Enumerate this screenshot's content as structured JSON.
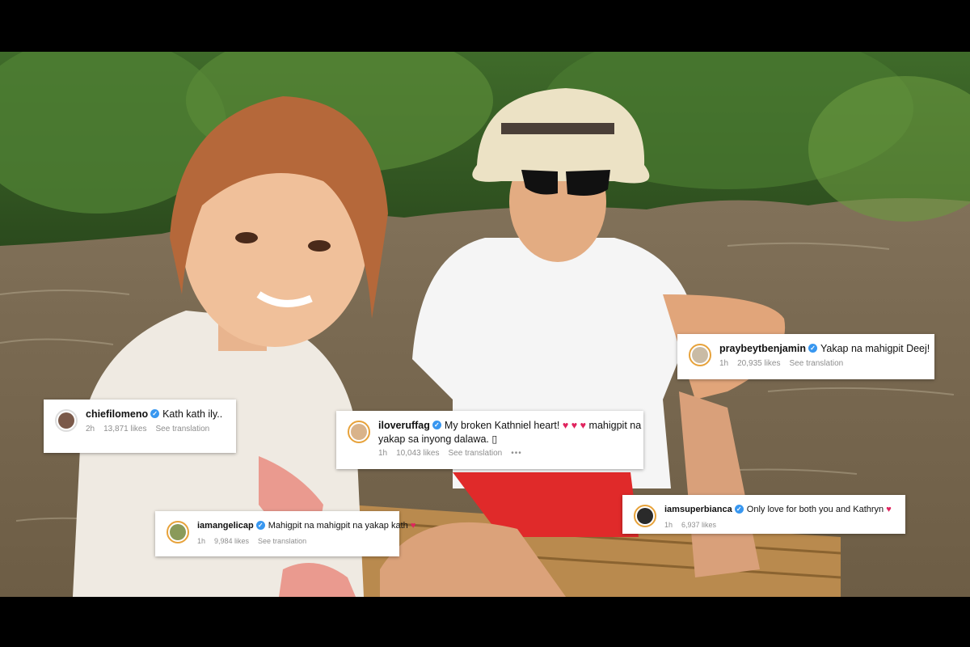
{
  "image": {
    "description_icons": [
      "verified-badge-icon",
      "heart-icon"
    ],
    "colors": {
      "verified": "#3897f0",
      "heart": "#e0245e",
      "story_ring": "#e7a23a"
    }
  },
  "comments": [
    {
      "username": "chiefilomeno",
      "text": "Kath kath ily..",
      "time": "2h",
      "likes": "13,871 likes",
      "translate": "See translation"
    },
    {
      "username": "iloveruffag",
      "text": "My broken Kathniel heart!",
      "hearts": "♥ ♥ ♥",
      "text2": "mahigpit na",
      "text3": "yakap sa inyong dalawa. ▯",
      "time": "1h",
      "likes": "10,043 likes",
      "translate": "See translation",
      "more": "•••"
    },
    {
      "username": "praybeytbenjamin",
      "text": "Yakap na mahigpit Deej!",
      "time": "1h",
      "likes": "20,935 likes",
      "translate": "See translation"
    },
    {
      "username": "iamangelicap",
      "text": "Mahigpit na mahigpit na yakap kath",
      "hearts": "♥",
      "time": "1h",
      "likes": "9,984 likes",
      "translate": "See translation"
    },
    {
      "username": "iamsuperbianca",
      "text": "Only love for both you and Kathryn",
      "hearts": "♥",
      "time": "1h",
      "likes": "6,937 likes"
    }
  ]
}
